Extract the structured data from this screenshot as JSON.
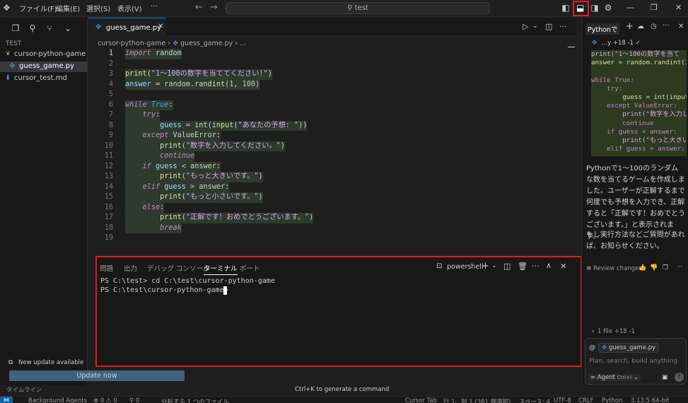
{
  "menu": {
    "items": [
      "ファイル(F)",
      "編集(E)",
      "選択(S)",
      "表示(V)",
      "···"
    ]
  },
  "search": {
    "text": "test"
  },
  "sidebar": {
    "root": "TEST",
    "folder": "cursor-python-game",
    "files": [
      "guess_game.py",
      "cursor_test.md"
    ],
    "timeline": "タイムライン"
  },
  "editor": {
    "tab": "guess_game.py",
    "breadcrumb": [
      "cursor-python-game",
      "guess_game.py",
      "..."
    ],
    "lines": [
      {
        "n": "1",
        "html": "<span class='kw'>import</span> <span class='plain'>random</span>"
      },
      {
        "n": "2",
        "html": ""
      },
      {
        "n": "3",
        "html": "<span class='fn'>print</span><span class='plain'>(</span><span class='strp'>\"1〜100の数字を当ててください!\"</span><span class='plain'>)</span>"
      },
      {
        "n": "4",
        "html": "<span class='var'>answer</span> <span class='plain'>= random.</span><span class='fn'>randint</span><span class='plain'>(</span><span class='num'>1</span><span class='plain'>, </span><span class='num'>100</span><span class='plain'>)</span>"
      },
      {
        "n": "5",
        "html": ""
      },
      {
        "n": "6",
        "html": "<span class='kw'>while</span> <span class='kw2'>True</span><span class='plain'>:</span>"
      },
      {
        "n": "7",
        "html": "<span class='guide'>····</span><span class='kw'>try</span><span class='plain'>:</span>"
      },
      {
        "n": "8",
        "html": "<span class='guide'>········</span><span class='var'>guess</span> <span class='plain'>= </span><span class='fn'>int</span><span class='plain'>(</span><span class='fn'>input</span><span class='plain'>(</span><span class='strp'>\"あなたの予想: \"</span><span class='plain'>))</span>"
      },
      {
        "n": "9",
        "html": "<span class='guide'>····</span><span class='kw'>except</span> <span class='plain'>ValueError:</span>"
      },
      {
        "n": "10",
        "html": "<span class='guide'>········</span><span class='fn'>print</span><span class='plain'>(</span><span class='strp'>\"数字を入力してください。\"</span><span class='plain'>)</span>"
      },
      {
        "n": "11",
        "html": "<span class='guide'>········</span><span class='kw'>continue</span>"
      },
      {
        "n": "12",
        "html": "<span class='guide'>····</span><span class='kw'>if</span> <span class='var'>guess</span> <span class='plain'>&lt; answer:</span>"
      },
      {
        "n": "13",
        "html": "<span class='guide'>········</span><span class='fn'>print</span><span class='plain'>(</span><span class='strp'>\"もっと大きいです。\"</span><span class='plain'>)</span>"
      },
      {
        "n": "14",
        "html": "<span class='guide'>····</span><span class='kw'>elif</span> <span class='var'>guess</span> <span class='plain'>&gt; answer:</span>"
      },
      {
        "n": "15",
        "html": "<span class='guide'>········</span><span class='fn'>print</span><span class='plain'>(</span><span class='strp'>\"もっと小さいです。\"</span><span class='plain'>)</span>"
      },
      {
        "n": "16",
        "html": "<span class='guide'>····</span><span class='kw'>else</span><span class='plain'>:</span>"
      },
      {
        "n": "17",
        "html": "<span class='guide'>········</span><span class='fn'>print</span><span class='plain'>(</span><span class='strp'>\"正解です！おめでとうございます。\"</span><span class='plain'>)</span>"
      },
      {
        "n": "18",
        "html": "<span class='guide'>········</span><span class='kw'>break</span>"
      },
      {
        "n": "19",
        "html": ""
      }
    ]
  },
  "panel": {
    "tabs": [
      "問題",
      "出力",
      "デバッグ コンソール",
      "ターミナル",
      "ポート"
    ],
    "active_tab": "ターミナル",
    "shell": "powershell",
    "terminal_lines": [
      "PS C:\\test> cd C:\\test\\cursor-python-game",
      "PS C:\\test\\cursor-python-game> "
    ],
    "hint": "Ctrl+K to generate a command"
  },
  "chat": {
    "tab": "Pythonで",
    "diff_label": "...y  +18 -1 ✓",
    "code": [
      "print(\"1〜100の数字を当て",
      "answer = random.randint(1",
      "",
      "while True:",
      "    try:",
      "        guess = int(input",
      "    except ValueError:",
      "        print(\"数字を入力し",
      "        continue",
      "    if guess < answer:",
      "        print(\"もっと大きい",
      "    elif guess > answer:"
    ],
    "message1": "Pythonで1〜100のランダムな数を当てるゲームを作成しました。ユーザーが正解するまで何度でも予想を入力でき、正解すると「正解です！おめでとうございます。」と表示されます。",
    "message2": "もし実行方法などご質問があれば、お知らせください。",
    "review": "Review changes",
    "files_changed": "1 file +18 -1",
    "context_file": "guess_game.py",
    "input_placeholder": "Plan, search, build anything",
    "agent": "Agent",
    "agent_shortcut": "Ctrl+I"
  },
  "update": {
    "title": "New update available",
    "button": "Update now"
  },
  "status": {
    "left": [
      "Background Agents",
      "⊗ 0 ⚠ 0",
      "⚲ 0",
      "分析する 1 つのファイル"
    ],
    "right": [
      "Cursor Tab",
      "行 1、列 1 (381 個選択)",
      "スペース: 4",
      "UTF-8",
      "CRLF",
      "Python",
      "3.13.5 64-bit"
    ]
  }
}
